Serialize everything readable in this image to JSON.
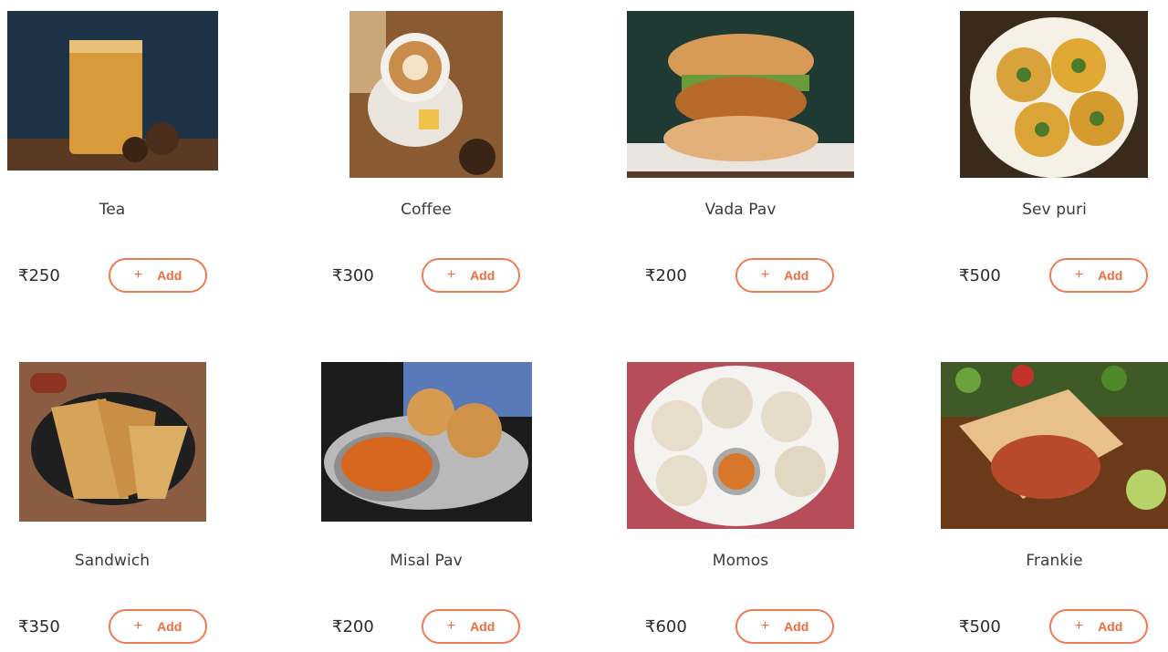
{
  "currency": "₹",
  "add_label": "Add",
  "accent_color": "#ef6b3d",
  "items": [
    {
      "name": "Tea",
      "price": "₹250"
    },
    {
      "name": "Coffee",
      "price": "₹300"
    },
    {
      "name": "Vada Pav",
      "price": "₹200"
    },
    {
      "name": "Sev puri",
      "price": "₹500"
    },
    {
      "name": "Sandwich",
      "price": "₹350"
    },
    {
      "name": "Misal Pav",
      "price": "₹200"
    },
    {
      "name": "Momos",
      "price": "₹600"
    },
    {
      "name": "Frankie",
      "price": "₹500"
    }
  ]
}
